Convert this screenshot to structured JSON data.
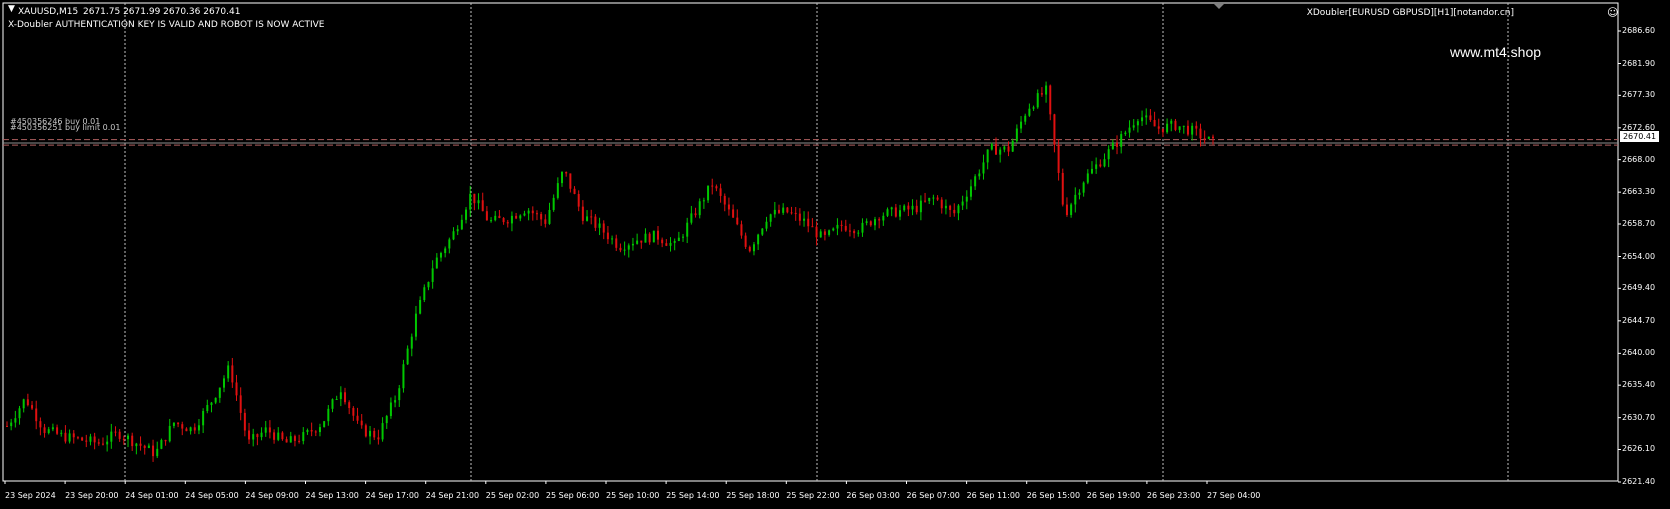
{
  "header": {
    "menu_glyph": "▼",
    "symbol": "XAUUSD,M15",
    "ohlc": "2671.75 2671.99 2670.36 2670.41",
    "message": "X-Doubler AUTHENTICATION KEY IS VALID AND ROBOT IS NOW ACTIVE"
  },
  "expert": {
    "name": "XDoubler[EURUSD GBPUSD][H1][notandor.cn]",
    "icon": "smiley-icon",
    "glyph": "☺"
  },
  "watermark": "www.mt4.shop",
  "orders": [
    {
      "label": "#450356246 buy 0.01",
      "price": 2670.9
    },
    {
      "label": "#450356251 buy limit 0.01",
      "price": 2670.1
    }
  ],
  "bid": "2670.41",
  "colors": {
    "bull": "#00c800",
    "bear": "#e01010",
    "grid": "#c0c0c0",
    "order_line": "#b06060",
    "background": "#000000"
  },
  "price_axis": [
    "2686.60",
    "2681.90",
    "2677.30",
    "2672.60",
    "2668.00",
    "2663.30",
    "2658.70",
    "2654.00",
    "2649.40",
    "2644.70",
    "2640.00",
    "2635.40",
    "2630.70",
    "2626.10",
    "2621.40"
  ],
  "time_axis": [
    "23 Sep 2024",
    "23 Sep 20:00",
    "24 Sep 01:00",
    "24 Sep 05:00",
    "24 Sep 09:00",
    "24 Sep 13:00",
    "24 Sep 17:00",
    "24 Sep 21:00",
    "25 Sep 02:00",
    "25 Sep 06:00",
    "25 Sep 10:00",
    "25 Sep 14:00",
    "25 Sep 18:00",
    "25 Sep 22:00",
    "26 Sep 03:00",
    "26 Sep 07:00",
    "26 Sep 11:00",
    "26 Sep 15:00",
    "26 Sep 19:00",
    "26 Sep 23:00",
    "27 Sep 04:00"
  ],
  "chart_data": {
    "type": "candlestick",
    "symbol": "XAUUSD",
    "timeframe": "M15",
    "ylim": [
      2621.4,
      2686.6
    ],
    "grid": "vertical dotted at day separators",
    "close_path": [
      2629.5,
      2633.5,
      2629.0,
      2628.0,
      2627.5,
      2627.0,
      2628.5,
      2627.0,
      2625.5,
      2630.0,
      2629.0,
      2633.0,
      2638.0,
      2627.0,
      2629.0,
      2627.0,
      2628.0,
      2630.0,
      2635.0,
      2629.0,
      2628.0,
      2634.0,
      2645.0,
      2653.0,
      2657.0,
      2663.0,
      2659.0,
      2659.5,
      2661.0,
      2659.0,
      2666.5,
      2660.0,
      2658.0,
      2655.5,
      2656.5,
      2657.0,
      2655.5,
      2660.0,
      2664.5,
      2660.0,
      2655.0,
      2660.0,
      2660.5,
      2659.0,
      2656.5,
      2658.5,
      2658.0,
      2660.0,
      2660.5,
      2661.0,
      2662.5,
      2660.0,
      2664.5,
      2669.5,
      2669.5,
      2675.5,
      2678.0,
      2660.0,
      2665.0,
      2668.0,
      2671.0,
      2674.5,
      2672.5,
      2673.0,
      2672.0,
      2670.4
    ]
  }
}
